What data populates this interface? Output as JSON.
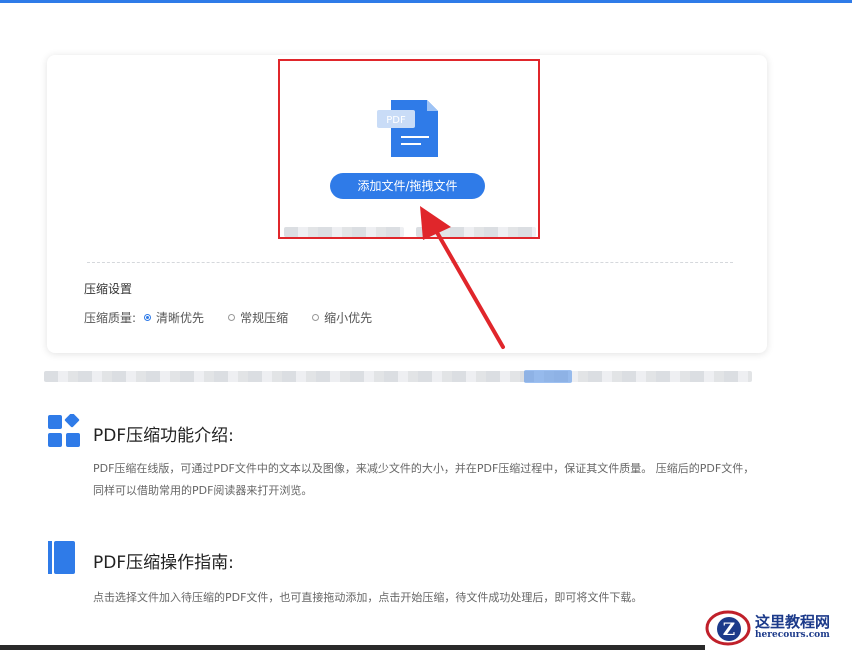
{
  "upload": {
    "button_label": "添加文件/拖拽文件",
    "icon_label": "PDF"
  },
  "settings": {
    "title": "压缩设置",
    "quality_label": "压缩质量:",
    "options": [
      {
        "label": "清晰优先",
        "selected": true
      },
      {
        "label": "常规压缩",
        "selected": false
      },
      {
        "label": "缩小优先",
        "selected": false
      }
    ]
  },
  "sections": [
    {
      "title": "PDF压缩功能介绍:",
      "icon": "grid-apps-icon",
      "description": "PDF压缩在线版，可通过PDF文件中的文本以及图像，来减少文件的大小，并在PDF压缩过程中，保证其文件质量。 压缩后的PDF文件，同样可以借助常用的PDF阅读器来打开浏览。"
    },
    {
      "title": "PDF压缩操作指南:",
      "icon": "book-icon",
      "description": "点击选择文件加入待压缩的PDF文件，也可直接拖动添加，点击开始压缩，待文件成功处理后，即可将文件下载。"
    }
  ],
  "watermark": {
    "name": "这里教程网",
    "url": "herecours.com",
    "logo_letter": "Z"
  },
  "colors": {
    "accent": "#2f7be8",
    "highlight": "#e0262b"
  }
}
